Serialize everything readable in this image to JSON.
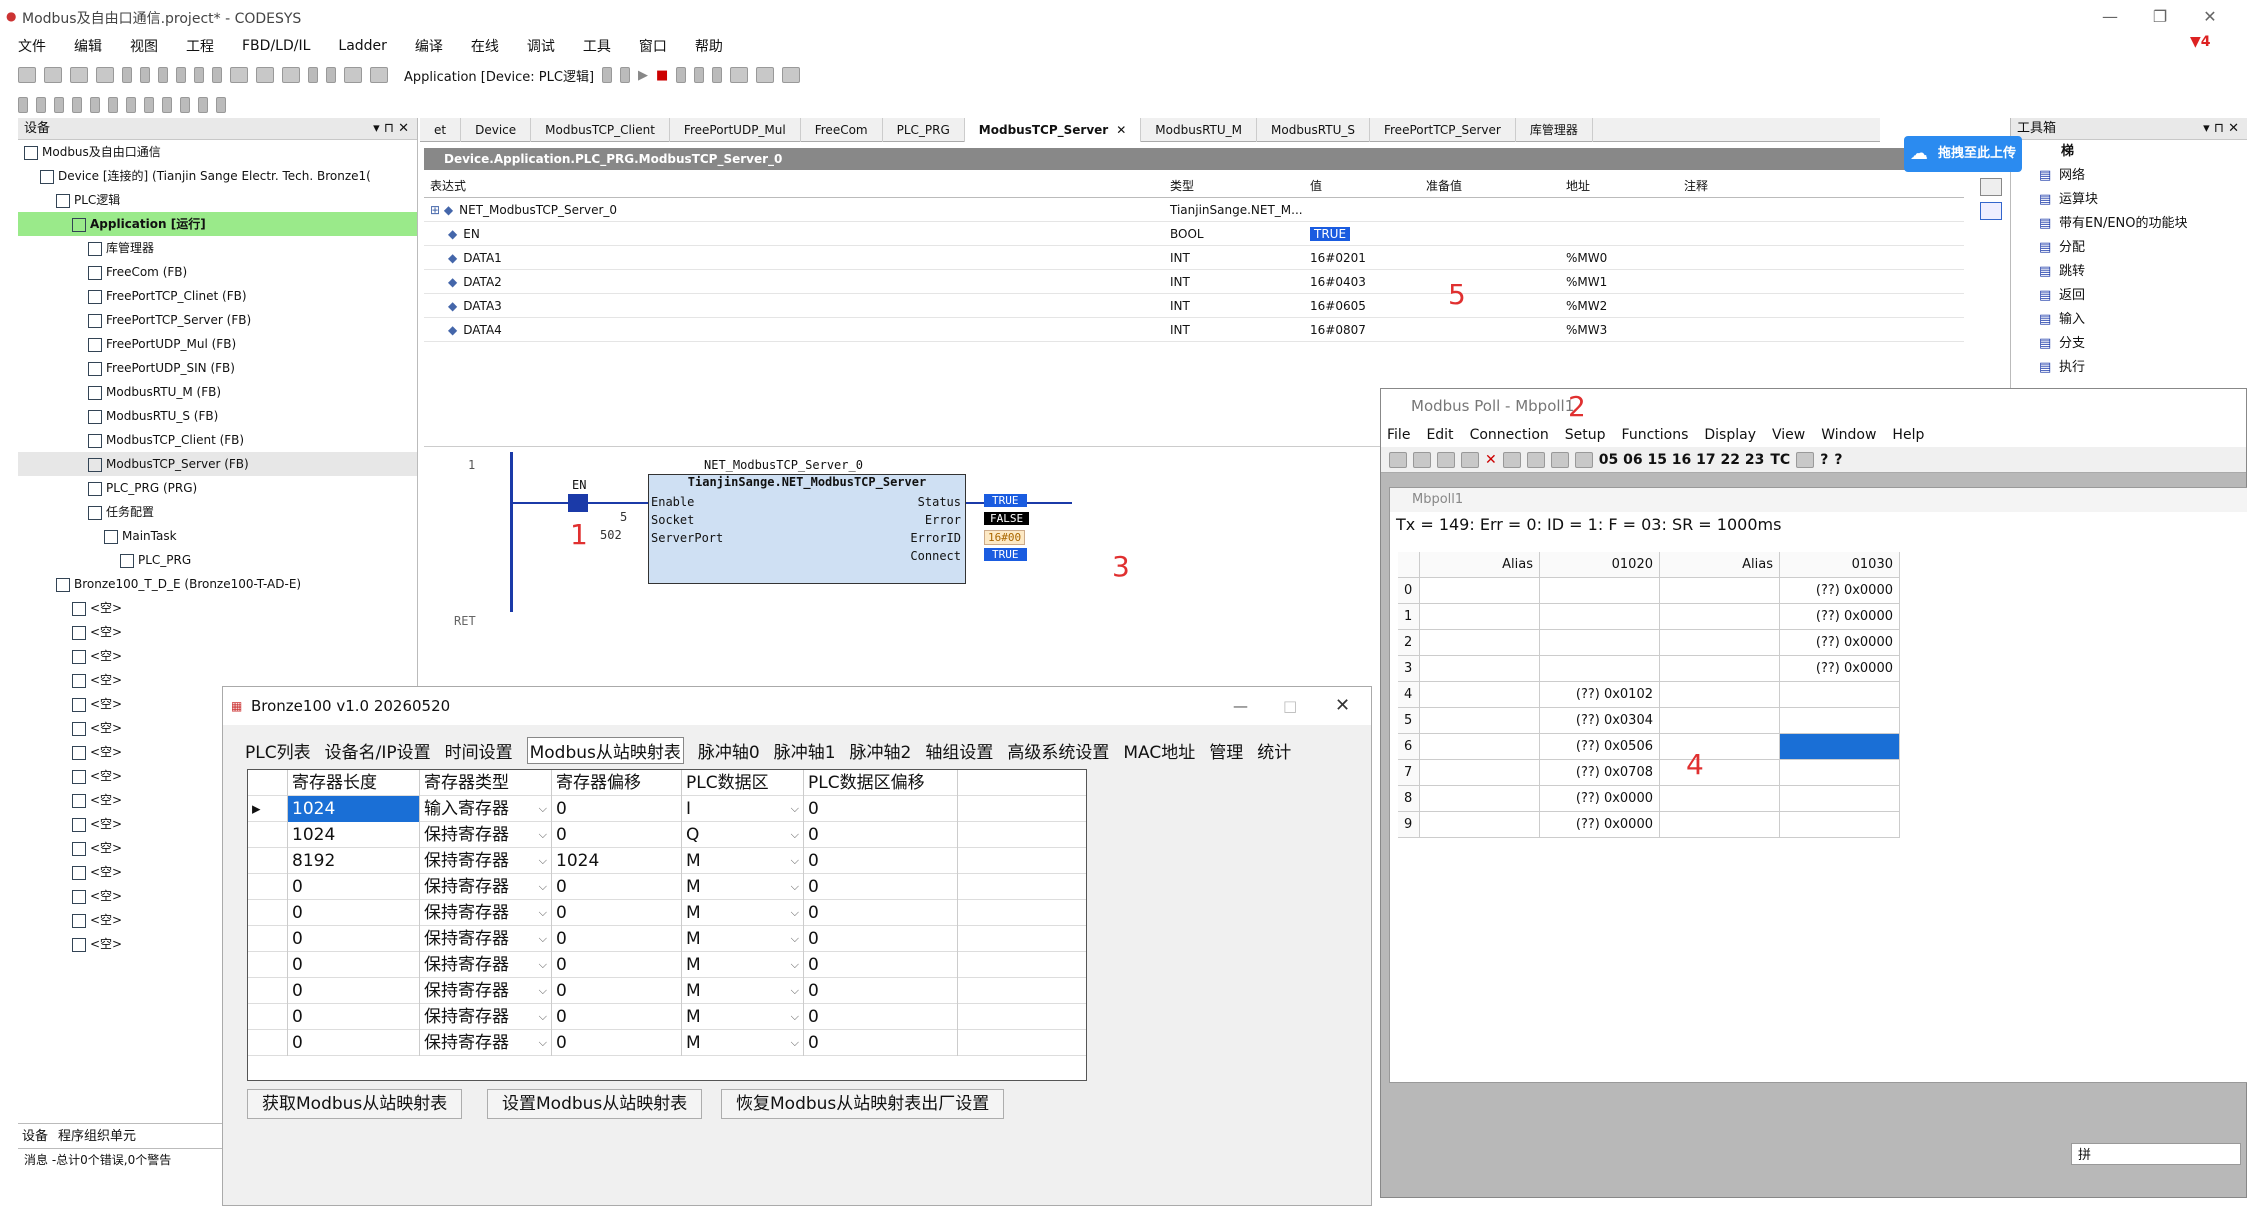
{
  "app": {
    "title": "Modbus及自由口通信.project* - CODESYS",
    "menu": [
      "文件",
      "编辑",
      "视图",
      "工程",
      "FBD/LD/IL",
      "Ladder",
      "编译",
      "在线",
      "调试",
      "工具",
      "窗口",
      "帮助"
    ],
    "app_selector": "Application [Device: PLC逻辑]",
    "error_count": "4"
  },
  "devices": {
    "header": "设备",
    "tree": [
      {
        "text": "Modbus及自由口通信",
        "indent": 0
      },
      {
        "text": "Device [连接的] (Tianjin Sange Electr. Tech. Bronze1(",
        "indent": 1
      },
      {
        "text": "PLC逻辑",
        "indent": 2
      },
      {
        "text": "Application [运行]",
        "indent": 3,
        "hl": true
      },
      {
        "text": "库管理器",
        "indent": 4
      },
      {
        "text": "FreeCom (FB)",
        "indent": 4
      },
      {
        "text": "FreePortTCP_Clinet (FB)",
        "indent": 4
      },
      {
        "text": "FreePortTCP_Server (FB)",
        "indent": 4
      },
      {
        "text": "FreePortUDP_Mul (FB)",
        "indent": 4
      },
      {
        "text": "FreePortUDP_SIN (FB)",
        "indent": 4
      },
      {
        "text": "ModbusRTU_M (FB)",
        "indent": 4
      },
      {
        "text": "ModbusRTU_S (FB)",
        "indent": 4
      },
      {
        "text": "ModbusTCP_Client (FB)",
        "indent": 4
      },
      {
        "text": "ModbusTCP_Server (FB)",
        "indent": 4,
        "sel": true
      },
      {
        "text": "PLC_PRG (PRG)",
        "indent": 4
      },
      {
        "text": "任务配置",
        "indent": 4
      },
      {
        "text": "MainTask",
        "indent": 5
      },
      {
        "text": "PLC_PRG",
        "indent": 6
      },
      {
        "text": "Bronze100_T_D_E (Bronze100-T-AD-E)",
        "indent": 2
      },
      {
        "text": "<空>",
        "indent": 3
      },
      {
        "text": "<空>",
        "indent": 3
      },
      {
        "text": "<空>",
        "indent": 3
      },
      {
        "text": "<空>",
        "indent": 3
      },
      {
        "text": "<空>",
        "indent": 3
      },
      {
        "text": "<空>",
        "indent": 3
      },
      {
        "text": "<空>",
        "indent": 3
      },
      {
        "text": "<空>",
        "indent": 3
      },
      {
        "text": "<空>",
        "indent": 3
      },
      {
        "text": "<空>",
        "indent": 3
      },
      {
        "text": "<空>",
        "indent": 3
      },
      {
        "text": "<空>",
        "indent": 3
      },
      {
        "text": "<空>",
        "indent": 3
      },
      {
        "text": "<空>",
        "indent": 3
      },
      {
        "text": "<空>",
        "indent": 3
      }
    ],
    "bottom_tabs": [
      "设备",
      "程序组织单元"
    ],
    "messages": "消息 -总计0个错误,0个警告"
  },
  "tabs": [
    "et",
    "Device",
    "ModbusTCP_Client",
    "FreePortUDP_Mul",
    "FreeCom",
    "PLC_PRG",
    "ModbusTCP_Server",
    "ModbusRTU_M",
    "ModbusRTU_S",
    "FreePortTCP_Server",
    "库管理器"
  ],
  "active_tab": "ModbusTCP_Server",
  "editor": {
    "path": "Device.Application.PLC_PRG.ModbusTCP_Server_0",
    "headers": [
      "表达式",
      "类型",
      "值",
      "准备值",
      "地址",
      "注释"
    ],
    "rows": [
      [
        "NET_ModbusTCP_Server_0",
        "TianjinSange.NET_M...",
        "",
        "",
        "",
        ""
      ],
      [
        "EN",
        "BOOL",
        "TRUE",
        "",
        "",
        ""
      ],
      [
        "DATA1",
        "INT",
        "16#0201",
        "",
        "%MW0",
        ""
      ],
      [
        "DATA2",
        "INT",
        "16#0403",
        "",
        "%MW1",
        ""
      ],
      [
        "DATA3",
        "INT",
        "16#0605",
        "",
        "%MW2",
        ""
      ],
      [
        "DATA4",
        "INT",
        "16#0807",
        "",
        "%MW3",
        ""
      ]
    ]
  },
  "ladder": {
    "rung": "1",
    "fb_instance": "NET_ModbusTCP_Server_0",
    "fb_type": "TianjinSange.NET_ModbusTCP_Server",
    "contact": "EN",
    "inputs": [
      "Enable",
      "Socket",
      "ServerPort"
    ],
    "input_vals": [
      "",
      "5",
      "502"
    ],
    "outputs": [
      "Status",
      "Error",
      "ErrorID",
      "Connect"
    ],
    "output_vals": [
      "TRUE",
      "FALSE",
      "16#00",
      "TRUE"
    ],
    "ret": "RET"
  },
  "tools": {
    "header": "工具箱",
    "group": "梯",
    "items": [
      "网络",
      "运算块",
      "带有EN/ENO的功能块",
      "分配",
      "跳转",
      "返回",
      "输入",
      "分支",
      "执行"
    ],
    "upload": "拖拽至此上传"
  },
  "mbpoll": {
    "title": "Modbus Poll - Mbpoll1",
    "menu": [
      "File",
      "Edit",
      "Connection",
      "Setup",
      "Functions",
      "Display",
      "View",
      "Window",
      "Help"
    ],
    "toolbar_codes": "05 06 15 16 17 22 23",
    "tc": "TC",
    "child_title": "Mbpoll1",
    "status": "Tx = 149: Err = 0: ID = 1: F = 03: SR = 1000ms",
    "grid_headers": [
      "",
      "Alias",
      "01020",
      "Alias",
      "01030"
    ],
    "grid": [
      [
        "0",
        "",
        "",
        "",
        "(??) 0x0000"
      ],
      [
        "1",
        "",
        "",
        "",
        "(??) 0x0000"
      ],
      [
        "2",
        "",
        "",
        "",
        "(??) 0x0000"
      ],
      [
        "3",
        "",
        "",
        "",
        "(??) 0x0000"
      ],
      [
        "4",
        "",
        "(??) 0x0102",
        "",
        ""
      ],
      [
        "5",
        "",
        "(??) 0x0304",
        "",
        ""
      ],
      [
        "6",
        "",
        "(??) 0x0506",
        "",
        ""
      ],
      [
        "7",
        "",
        "(??) 0x0708",
        "",
        ""
      ],
      [
        "8",
        "",
        "(??) 0x0000",
        "",
        ""
      ],
      [
        "9",
        "",
        "(??) 0x0000",
        "",
        ""
      ]
    ],
    "status_text": "拼"
  },
  "bronze": {
    "title": "Bronze100 v1.0 20260520",
    "tabs": [
      "PLC列表",
      "设备名/IP设置",
      "时间设置",
      "Modbus从站映射表",
      "脉冲轴0",
      "脉冲轴1",
      "脉冲轴2",
      "轴组设置",
      "高级系统设置",
      "MAC地址",
      "管理",
      "统计"
    ],
    "active_tab": "Modbus从站映射表",
    "headers": [
      "",
      "寄存器长度",
      "寄存器类型",
      "寄存器偏移",
      "PLC数据区",
      "PLC数据区偏移"
    ],
    "rows": [
      [
        "▸",
        "1024",
        "输入寄存器",
        "0",
        "I",
        "0"
      ],
      [
        "",
        "1024",
        "保持寄存器",
        "0",
        "Q",
        "0"
      ],
      [
        "",
        "8192",
        "保持寄存器",
        "1024",
        "M",
        "0"
      ],
      [
        "",
        "0",
        "保持寄存器",
        "0",
        "M",
        "0"
      ],
      [
        "",
        "0",
        "保持寄存器",
        "0",
        "M",
        "0"
      ],
      [
        "",
        "0",
        "保持寄存器",
        "0",
        "M",
        "0"
      ],
      [
        "",
        "0",
        "保持寄存器",
        "0",
        "M",
        "0"
      ],
      [
        "",
        "0",
        "保持寄存器",
        "0",
        "M",
        "0"
      ],
      [
        "",
        "0",
        "保持寄存器",
        "0",
        "M",
        "0"
      ],
      [
        "",
        "0",
        "保持寄存器",
        "0",
        "M",
        "0"
      ]
    ],
    "buttons": [
      "获取Modbus从站映射表",
      "设置Modbus从站映射表",
      "恢复Modbus从站映射表出厂设置"
    ]
  },
  "annotations": [
    "1",
    "2",
    "3",
    "4",
    "5"
  ],
  "colors": {
    "selection": "#1a6fd6",
    "running": "#9aea8a",
    "annot": "#e03030"
  }
}
